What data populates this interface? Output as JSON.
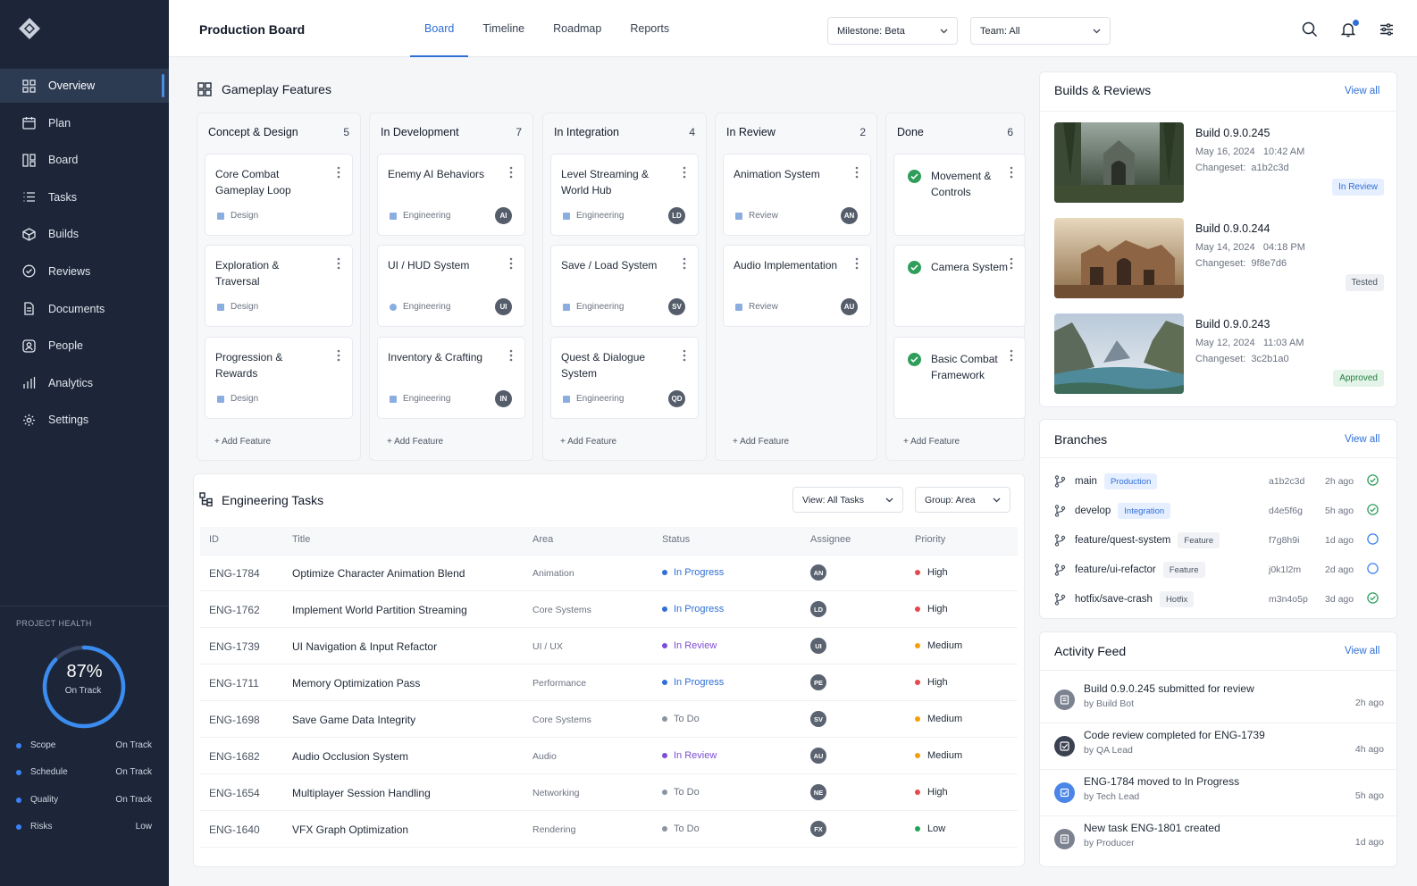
{
  "app": {
    "title": "Production Board"
  },
  "tabs": [
    {
      "label": "Board"
    },
    {
      "label": "Timeline"
    },
    {
      "label": "Roadmap"
    },
    {
      "label": "Reports"
    }
  ],
  "filters": {
    "milestone": "Milestone: Beta",
    "team": "Team: All"
  },
  "sidebar": {
    "items": [
      {
        "label": "Overview",
        "icon": "grid-icon"
      },
      {
        "label": "Plan",
        "icon": "calendar-icon"
      },
      {
        "label": "Board",
        "icon": "board-icon"
      },
      {
        "label": "Tasks",
        "icon": "list-icon"
      },
      {
        "label": "Builds",
        "icon": "package-icon"
      },
      {
        "label": "Reviews",
        "icon": "review-icon"
      },
      {
        "label": "Documents",
        "icon": "document-icon"
      },
      {
        "label": "People",
        "icon": "person-icon"
      },
      {
        "label": "Analytics",
        "icon": "bar-chart-icon"
      },
      {
        "label": "Settings",
        "icon": "gear-icon"
      }
    ],
    "health": {
      "title": "PROJECT HEALTH",
      "percent": "87%",
      "percent_value": 87,
      "status": "On Track",
      "metrics": [
        {
          "label": "Scope",
          "value": "On Track"
        },
        {
          "label": "Schedule",
          "value": "On Track"
        },
        {
          "label": "Quality",
          "value": "On Track"
        },
        {
          "label": "Risks",
          "value": "Low"
        }
      ]
    }
  },
  "board": {
    "title": "Gameplay Features",
    "add_label": "Add Feature",
    "columns": [
      {
        "name": "Concept & Design",
        "count": "5",
        "cards": [
          {
            "title": "Core Combat Gameplay Loop",
            "tag": "Design"
          },
          {
            "title": "Exploration & Traversal",
            "tag": "Design"
          },
          {
            "title": "Progression & Rewards",
            "tag": "Design"
          }
        ]
      },
      {
        "name": "In Development",
        "count": "7",
        "cards": [
          {
            "title": "Enemy AI Behaviors",
            "tag": "Engineering",
            "assignee": "AI"
          },
          {
            "title": "UI / HUD System",
            "tag": "Engineering",
            "assignee": "UI"
          },
          {
            "title": "Inventory & Crafting",
            "tag": "Engineering",
            "assignee": "IN"
          }
        ]
      },
      {
        "name": "In Integration",
        "count": "4",
        "cards": [
          {
            "title": "Level Streaming & World Hub",
            "tag": "Engineering",
            "assignee": "LD"
          },
          {
            "title": "Save / Load System",
            "tag": "Engineering",
            "assignee": "SV"
          },
          {
            "title": "Quest & Dialogue System",
            "tag": "Engineering",
            "assignee": "QD"
          }
        ]
      },
      {
        "name": "In Review",
        "count": "2",
        "cards": [
          {
            "title": "Animation System",
            "tag": "Review",
            "assignee": "AN"
          },
          {
            "title": "Audio Implementation",
            "tag": "Review",
            "assignee": "AU"
          }
        ]
      },
      {
        "name": "Done",
        "count": "6",
        "cards": [
          {
            "title": "Movement & Controls"
          },
          {
            "title": "Camera System"
          },
          {
            "title": "Basic Combat Framework"
          }
        ]
      }
    ]
  },
  "tasks": {
    "title": "Engineering Tasks",
    "view": "View: All Tasks",
    "group": "Group: Area",
    "headers": [
      "ID",
      "Title",
      "Area",
      "Status",
      "Assignee",
      "Priority"
    ],
    "rows": [
      {
        "id": "ENG-1784",
        "title": "Optimize Character Animation Blend",
        "area": "Animation",
        "status": "In Progress",
        "assignee": "AN",
        "priority": "High"
      },
      {
        "id": "ENG-1762",
        "title": "Implement World Partition Streaming",
        "area": "Core Systems",
        "status": "In Progress",
        "assignee": "LD",
        "priority": "High"
      },
      {
        "id": "ENG-1739",
        "title": "UI Navigation & Input Refactor",
        "area": "UI / UX",
        "status": "In Review",
        "assignee": "UI",
        "priority": "Medium"
      },
      {
        "id": "ENG-1711",
        "title": "Memory Optimization Pass",
        "area": "Performance",
        "status": "In Progress",
        "assignee": "PE",
        "priority": "High"
      },
      {
        "id": "ENG-1698",
        "title": "Save Game Data Integrity",
        "area": "Core Systems",
        "status": "To Do",
        "assignee": "SV",
        "priority": "Medium"
      },
      {
        "id": "ENG-1682",
        "title": "Audio Occlusion System",
        "area": "Audio",
        "status": "In Review",
        "assignee": "AU",
        "priority": "Medium"
      },
      {
        "id": "ENG-1654",
        "title": "Multiplayer Session Handling",
        "area": "Networking",
        "status": "To Do",
        "assignee": "NE",
        "priority": "High"
      },
      {
        "id": "ENG-1640",
        "title": "VFX Graph Optimization",
        "area": "Rendering",
        "status": "To Do",
        "assignee": "FX",
        "priority": "Low"
      }
    ]
  },
  "builds": {
    "title": "Builds & Reviews",
    "view_all": "View all",
    "items": [
      {
        "name": "Build 0.9.0.245",
        "date": "May 16, 2024",
        "time": "10:42 AM",
        "changeset_label": "Changeset:",
        "changeset": "a1b2c3d",
        "status": "In Review"
      },
      {
        "name": "Build 0.9.0.244",
        "date": "May 14, 2024",
        "time": "04:18 PM",
        "changeset_label": "Changeset:",
        "changeset": "9f8e7d6",
        "status": "Tested"
      },
      {
        "name": "Build 0.9.0.243",
        "date": "May 12, 2024",
        "time": "11:03 AM",
        "changeset_label": "Changeset:",
        "changeset": "3c2b1a0",
        "status": "Approved"
      }
    ]
  },
  "branches": {
    "title": "Branches",
    "view_all": "View all",
    "items": [
      {
        "name": "main",
        "tag": "Production",
        "hash": "a1b2c3d",
        "time": "2h ago",
        "state": "ok"
      },
      {
        "name": "develop",
        "tag": "Integration",
        "hash": "d4e5f6g",
        "time": "5h ago",
        "state": "ok"
      },
      {
        "name": "feature/quest-system",
        "tag": "Feature",
        "hash": "f7g8h9i",
        "time": "1d ago",
        "state": "pending"
      },
      {
        "name": "feature/ui-refactor",
        "tag": "Feature",
        "hash": "j0k1l2m",
        "time": "2d ago",
        "state": "pending"
      },
      {
        "name": "hotfix/save-crash",
        "tag": "Hotfix",
        "hash": "m3n4o5p",
        "time": "3d ago",
        "state": "ok"
      }
    ]
  },
  "activity": {
    "title": "Activity Feed",
    "view_all": "View all",
    "items": [
      {
        "title": "Build 0.9.0.245 submitted for review",
        "by": "by Build Bot",
        "time": "2h ago"
      },
      {
        "title": "Code review completed for ENG-1739",
        "by": "by QA Lead",
        "time": "4h ago"
      },
      {
        "title": "ENG-1784 moved to In Progress",
        "by": "by Tech Lead",
        "time": "5h ago"
      },
      {
        "title": "New task ENG-1801 created",
        "by": "by Producer",
        "time": "1d ago"
      }
    ]
  },
  "colors": {
    "accent": "#2f6fd6",
    "sidebar": "#1c2638",
    "status_in_progress": "#2f6fd6",
    "status_in_review": "#7c4dd6",
    "status_todo": "#8a93a1",
    "priority_high": "#e5484d",
    "priority_medium": "#f59e0b",
    "priority_low": "#22a35a",
    "done_check": "#2f9e5b"
  }
}
